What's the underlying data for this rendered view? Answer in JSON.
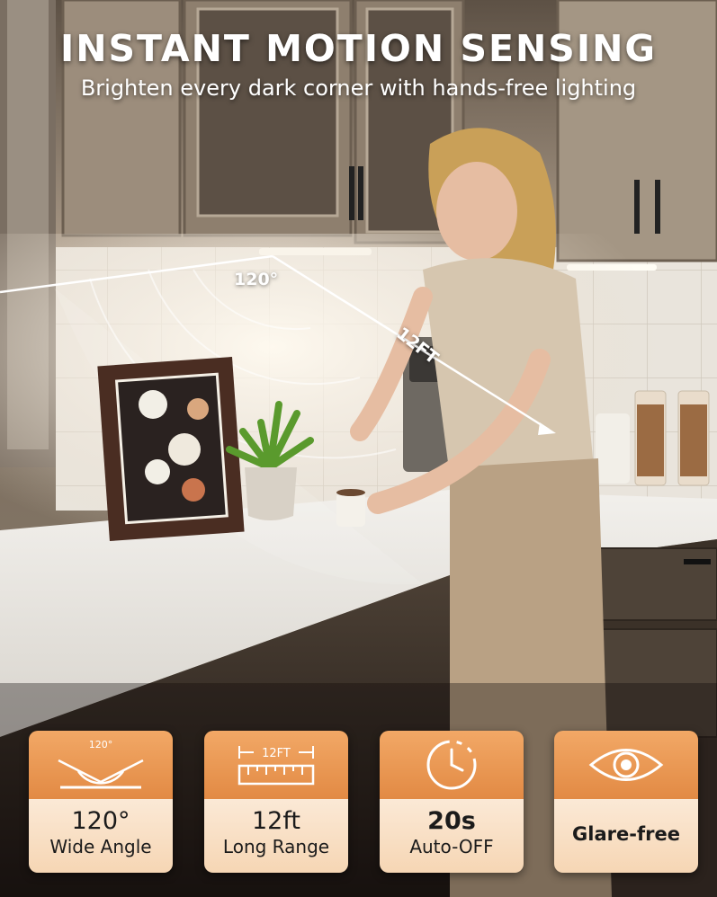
{
  "header": {
    "title": "INSTANT MOTION SENSING",
    "subtitle": "Brighten every dark corner with hands-free lighting"
  },
  "annotations": {
    "angle": "120°",
    "range": "12FT"
  },
  "features": [
    {
      "icon": "sensor-angle-icon",
      "icon_label": "120°",
      "value": "120°",
      "label": "Wide Angle"
    },
    {
      "icon": "ruler-range-icon",
      "icon_label": "12FT",
      "value": "12ft",
      "label": "Long Range"
    },
    {
      "icon": "timer-icon",
      "value": "20s",
      "label": "Auto-OFF"
    },
    {
      "icon": "eye-icon",
      "label": "Glare-free"
    }
  ],
  "colors": {
    "badge_top": "#e9954f",
    "badge_bottom": "#f9e2c7",
    "text_light": "#ffffff"
  }
}
